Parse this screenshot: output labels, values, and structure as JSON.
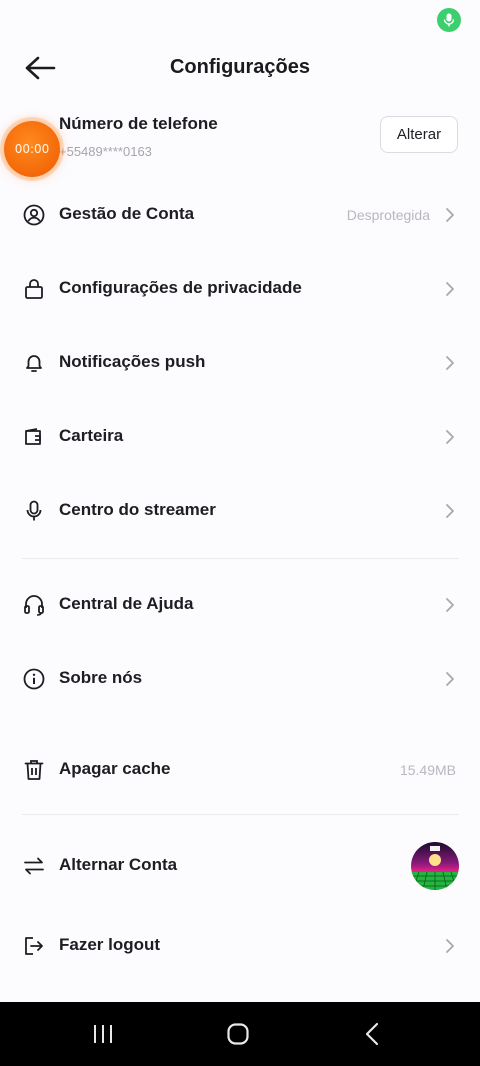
{
  "header": {
    "title": "Configurações"
  },
  "phone": {
    "label": "Número de telefone",
    "number": "+55489****0163",
    "change_label": "Alterar"
  },
  "timer": {
    "text": "00:00"
  },
  "menu": {
    "account": {
      "label": "Gestão de Conta",
      "value": "Desprotegida",
      "icon": "user-circle-icon"
    },
    "privacy": {
      "label": "Configurações de privacidade",
      "icon": "lock-icon"
    },
    "push": {
      "label": "Notificações push",
      "icon": "bell-icon"
    },
    "wallet": {
      "label": "Carteira",
      "icon": "wallet-icon"
    },
    "streamer": {
      "label": "Centro do streamer",
      "icon": "microphone-icon"
    },
    "help": {
      "label": "Central de Ajuda",
      "icon": "headset-icon"
    },
    "about": {
      "label": "Sobre nós",
      "icon": "info-icon"
    },
    "cache": {
      "label": "Apagar cache",
      "value": "15.49MB",
      "icon": "trash-icon"
    },
    "switch": {
      "label": "Alternar Conta",
      "icon": "swap-arrows-icon"
    },
    "logout": {
      "label": "Fazer logout",
      "icon": "logout-icon"
    }
  },
  "colors": {
    "accent_orange": "#f56d0c",
    "mic_green": "#3ccf6e",
    "text_primary": "#1d1d23",
    "text_muted": "#b9b7bf"
  }
}
